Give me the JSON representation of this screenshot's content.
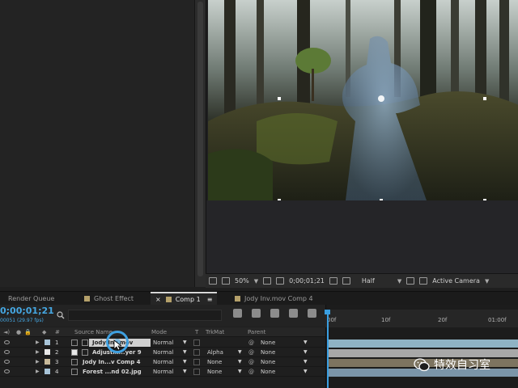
{
  "viewer": {
    "zoom": "50%",
    "timecode": "0;00;01;21",
    "resolution": "Half",
    "camera": "Active Camera"
  },
  "tabs": [
    {
      "label": "Render Queue",
      "color": "#1b1b1b"
    },
    {
      "label": "Ghost Effect",
      "color": "#b4a06a"
    },
    {
      "label": "Comp 1",
      "color": "#b4a06a"
    },
    {
      "label": "Jody Inv.mov Comp 4",
      "color": "#b4a06a"
    }
  ],
  "tab_close": "×",
  "tab_menu": "≡",
  "timeline": {
    "current_time": "0;00;01;21",
    "frames_info": "00051 (29.97 fps)",
    "ruler_labels": [
      "00f",
      "10f",
      "20f",
      "01:00f"
    ]
  },
  "columns": {
    "num": "#",
    "source_name": "Source Name",
    "mode": "Mode",
    "t": "T",
    "trkmat": "TrkMat",
    "parent": "Parent"
  },
  "layers": [
    {
      "num": "1",
      "name": "Jody Inv.mov",
      "mode": "Normal",
      "trkmat": "",
      "parent": "None",
      "label_color": "#a8c4d8",
      "bar_color": "#8fb3c4"
    },
    {
      "num": "2",
      "name": "Adjustm...yer 9",
      "mode": "Normal",
      "trkmat": "Alpha",
      "parent": "None",
      "label_color": "#e8e8e8",
      "bar_color": "#a8a8a8"
    },
    {
      "num": "3",
      "name": "Jody In...v Comp 4",
      "mode": "Normal",
      "trkmat": "None",
      "parent": "None",
      "label_color": "#c7b99a",
      "bar_color": "#7d7460"
    },
    {
      "num": "4",
      "name": "Forest ...nd 02.jpg",
      "mode": "Normal",
      "trkmat": "None",
      "parent": "None",
      "label_color": "#a8c4d8",
      "bar_color": "#7b95a8"
    }
  ],
  "watermark": {
    "text": "特效自习室"
  },
  "icons": [
    "search-icon",
    "wechat-icon",
    "mouse-pointer-icon",
    "eye-icon",
    "camera-icon"
  ],
  "colors": {
    "accent": "#45a7e2",
    "panel": "#232323"
  }
}
